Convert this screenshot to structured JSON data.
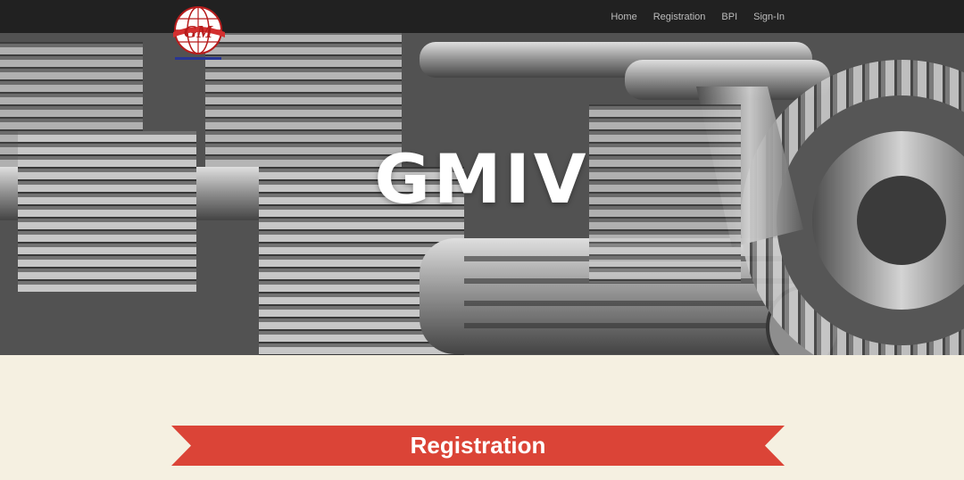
{
  "nav": {
    "items": [
      {
        "label": "Home"
      },
      {
        "label": "Registration"
      },
      {
        "label": "BPI"
      },
      {
        "label": "Sign-In"
      }
    ]
  },
  "logo": {
    "text": "GM"
  },
  "hero": {
    "title": "GMIV"
  },
  "section": {
    "heading": "Registration"
  },
  "colors": {
    "navbar": "#212121",
    "ribbon": "#db4437",
    "background": "#f5f0e1",
    "logo_red": "#d32f2f",
    "logo_blue": "#283593"
  }
}
